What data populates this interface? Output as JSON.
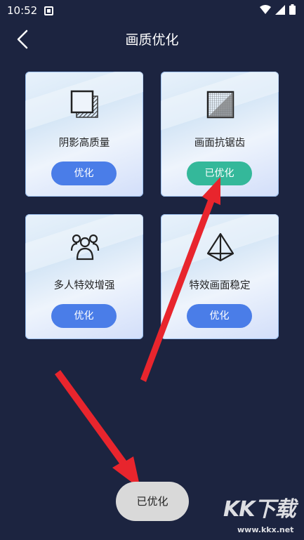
{
  "status": {
    "time": "10:52"
  },
  "header": {
    "title": "画质优化",
    "back_icon": "chevron-left-icon"
  },
  "cards": [
    {
      "label": "阴影高质量",
      "button": "优化",
      "icon": "shadow-squares-icon",
      "state": "default"
    },
    {
      "label": "画面抗锯齿",
      "button": "已优化",
      "icon": "antialias-grid-icon",
      "state": "done"
    },
    {
      "label": "多人特效增强",
      "button": "优化",
      "icon": "people-group-icon",
      "state": "default"
    },
    {
      "label": "特效画面稳定",
      "button": "优化",
      "icon": "pyramid-icon",
      "state": "default"
    }
  ],
  "toast": {
    "text": "已优化"
  },
  "watermark": {
    "main": "KK下载",
    "url": "www.kkx.net"
  },
  "colors": {
    "background": "#1c2440",
    "button_default": "#4a7de8",
    "button_done": "#34b89a",
    "arrow": "#e8252d"
  }
}
